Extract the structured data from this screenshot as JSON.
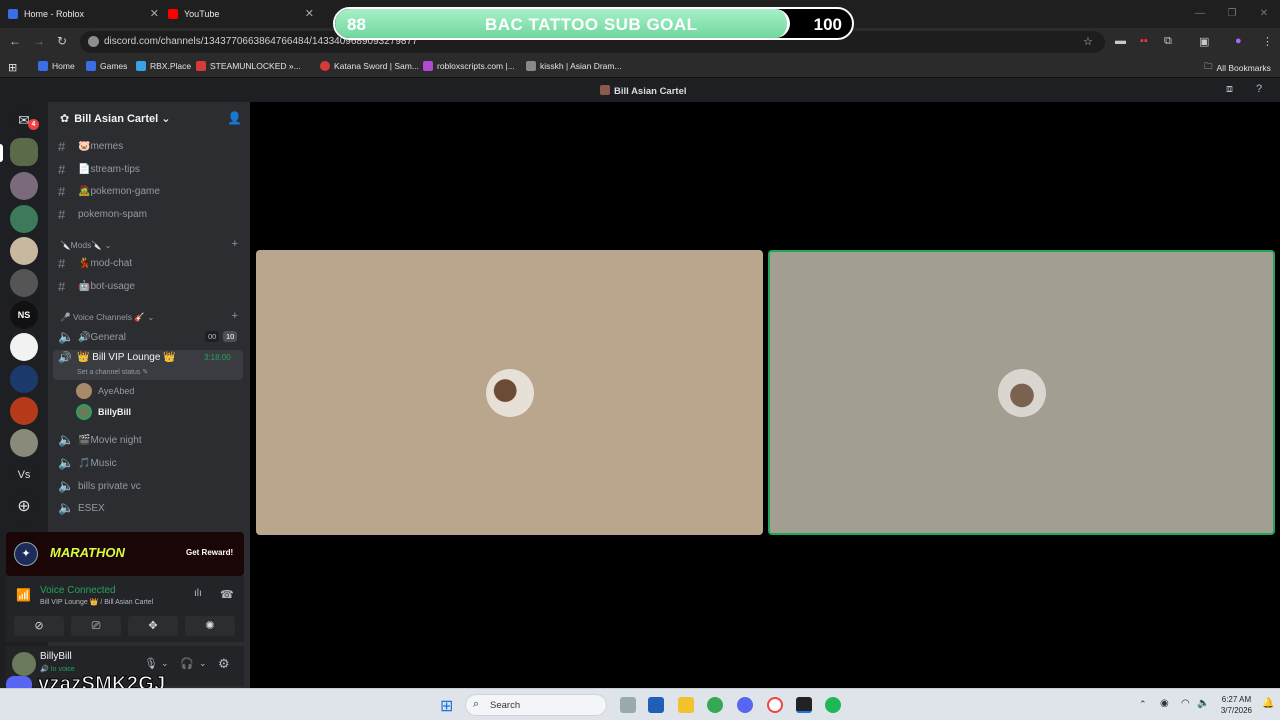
{
  "browser": {
    "tabs": [
      {
        "label": "Home - Roblox",
        "color": "#3a6ee8"
      },
      {
        "label": "YouTube",
        "color": "#ff0000"
      }
    ],
    "url": "discord.com/channels/1343770663864766484/1433409689093279877",
    "bookmarks": [
      {
        "label": "Home",
        "color": "#3a6ee8"
      },
      {
        "label": "Games",
        "color": "#3a6ee8"
      },
      {
        "label": "RBX.Place",
        "color": "#3aa3e8"
      },
      {
        "label": "STEAMUNLOCKED »...",
        "color": "#d83a3a"
      },
      {
        "label": "Katana Sword | Sam...",
        "color": "#d83a3a"
      },
      {
        "label": "robloxscripts.com |...",
        "color": "#b04ad0"
      },
      {
        "label": "kisskh | Asian Dram...",
        "color": "#888888"
      }
    ],
    "all_bookmarks": "All Bookmarks"
  },
  "goal": {
    "current": "88",
    "title": "BAC TATTOO SUB GOAL",
    "target": "100",
    "progress": 0.88
  },
  "discord": {
    "window_title": "Bill Asian Cartel",
    "server_name": "Bill Asian Cartel",
    "dm_badge": "4",
    "channels_top": [
      {
        "label": "memes",
        "emoji": "🐷"
      },
      {
        "label": "stream-tips",
        "emoji": "📄"
      },
      {
        "label": "pokemon-game",
        "emoji": "🧟"
      },
      {
        "label": "pokemon-spam",
        "emoji": ""
      }
    ],
    "mods_category": "Mods",
    "mod_channels": [
      {
        "label": "mod-chat",
        "emoji": "💃"
      },
      {
        "label": "bot-usage",
        "emoji": "🤖"
      }
    ],
    "voice_category": "Voice Channels",
    "voice_channels": {
      "general": {
        "label": "General",
        "emoji": "🔊",
        "count_a": "00",
        "count_b": "10"
      },
      "vip": {
        "label": "Bill VIP Lounge",
        "timer": "3:18:00",
        "status": "Set a channel status"
      },
      "vip_users": [
        "AyeAbed",
        "BillyBill"
      ],
      "others": [
        {
          "label": "Movie night",
          "emoji": "🎬"
        },
        {
          "label": "Music",
          "emoji": "🎵"
        },
        {
          "label": "bills private vc",
          "emoji": ""
        },
        {
          "label": "ESEX",
          "emoji": ""
        }
      ]
    },
    "marathon": {
      "label": "MARATHON",
      "button": "Get Reward!"
    },
    "voice_connected": {
      "status": "Voice Connected",
      "location": "Bill VIP Lounge 👑 / Bill Asian Cartel"
    },
    "user": {
      "name": "BillyBill",
      "status": "In voice"
    }
  },
  "watermark": "vzazSMK2GJ",
  "taskbar": {
    "search": "Search",
    "time": "6:27 AM",
    "date": "3/7/2026"
  }
}
